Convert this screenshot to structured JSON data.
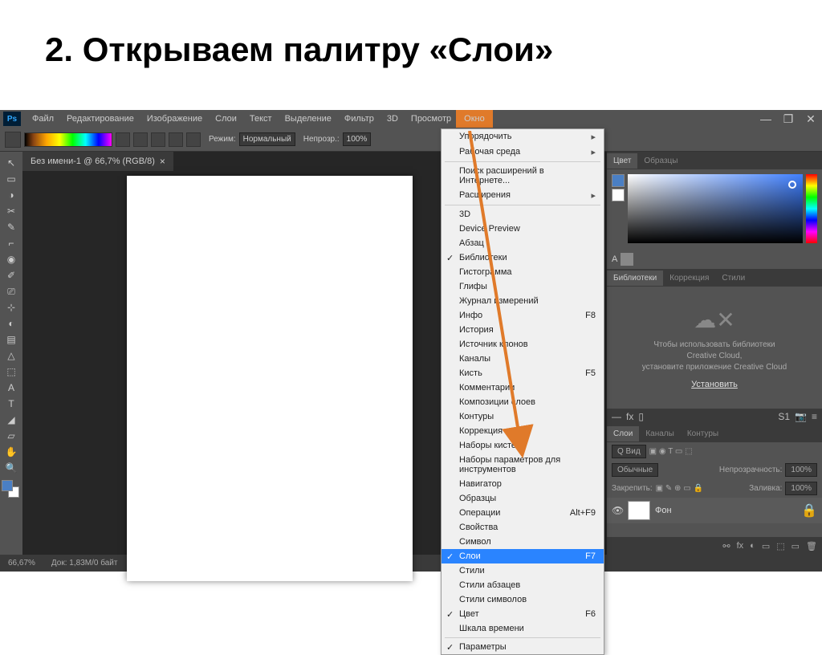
{
  "slide": {
    "title": "2. Открываем палитру «Слои»"
  },
  "menubar": {
    "items": [
      "Файл",
      "Редактирование",
      "Изображение",
      "Слои",
      "Текст",
      "Выделение",
      "Фильтр",
      "3D",
      "Просмотр",
      "Окно"
    ],
    "highlighted": "Окно"
  },
  "window_controls": {
    "minimize": "—",
    "maximize": "❐",
    "close": "✕"
  },
  "optionbar": {
    "mode_label": "Режим:",
    "mode_value": "Нормальный",
    "opacity_label": "Непрозр.:",
    "opacity_value": "100%"
  },
  "doc_tab": {
    "title": "Без имени-1 @ 66,7% (RGB/8)",
    "close": "×"
  },
  "tools": [
    "↖",
    "▭",
    "◑",
    "✂",
    "✎",
    "⌐",
    "◉",
    "✐",
    "⎚",
    "⊹",
    "◐",
    "▤",
    "△",
    "⬚",
    "A",
    "T",
    "◢",
    "▱",
    "✋",
    "🔍"
  ],
  "panels": {
    "color_tabs": [
      "Цвет",
      "Образцы"
    ],
    "char_label": "A",
    "lib_tabs": [
      "Библиотеки",
      "Коррекция",
      "Стили"
    ],
    "lib_text1": "Чтобы использовать библиотеки",
    "lib_text2": "Creative Cloud,",
    "lib_text3": "установите приложение Creative Cloud",
    "lib_link": "Установить",
    "fx_bar": {
      "dash": "—",
      "fx": "fx",
      "sq": "▯",
      "s1": "S1",
      "cam": "📷",
      "menu": "≡"
    },
    "layer_tabs": [
      "Слои",
      "Каналы",
      "Контуры"
    ],
    "layer_opts": {
      "kind": "Q Вид",
      "icons": "▣ ◉ T ▭ ⬚",
      "blend": "Обычные",
      "op_label": "Непрозрачность:",
      "op_val": "100%",
      "lock_label": "Закрепить:",
      "lock_icons": "▣ ✎ ⊕ ▭ 🔒",
      "fill_label": "Заливка:",
      "fill_val": "100%"
    },
    "layer": {
      "name": "Фон",
      "lock": "🔒"
    },
    "layer_bottom": [
      "⊕",
      "fx",
      "◐",
      "▭",
      "⬚",
      "🗑"
    ]
  },
  "statusbar": {
    "zoom": "66,67%",
    "doc": "Док: 1,83М/0 байт"
  },
  "dropdown": {
    "items": [
      {
        "label": "Упорядочить",
        "submenu": true
      },
      {
        "label": "Рабочая среда",
        "submenu": true
      },
      {
        "sep": true
      },
      {
        "label": "Поиск расширений в Интернете..."
      },
      {
        "label": "Расширения",
        "submenu": true
      },
      {
        "sep": true
      },
      {
        "label": "3D"
      },
      {
        "label": "Device Preview"
      },
      {
        "label": "Абзац"
      },
      {
        "label": "Библиотеки",
        "checked": true
      },
      {
        "label": "Гистограмма"
      },
      {
        "label": "Глифы"
      },
      {
        "label": "Журнал измерений"
      },
      {
        "label": "Инфо",
        "shortcut": "F8"
      },
      {
        "label": "История"
      },
      {
        "label": "Источник клонов"
      },
      {
        "label": "Каналы"
      },
      {
        "label": "Кисть",
        "shortcut": "F5"
      },
      {
        "label": "Комментарии"
      },
      {
        "label": "Композиции слоев"
      },
      {
        "label": "Контуры"
      },
      {
        "label": "Коррекция"
      },
      {
        "label": "Наборы кистей"
      },
      {
        "label": "Наборы параметров для инструментов"
      },
      {
        "label": "Навигатор"
      },
      {
        "label": "Образцы"
      },
      {
        "label": "Операции",
        "shortcut": "Alt+F9"
      },
      {
        "label": "Свойства"
      },
      {
        "label": "Символ"
      },
      {
        "label": "Слои",
        "shortcut": "F7",
        "checked": true,
        "highlighted": true
      },
      {
        "label": "Стили"
      },
      {
        "label": "Стили абзацев"
      },
      {
        "label": "Стили символов"
      },
      {
        "label": "Цвет",
        "checked": true,
        "shortcut": "F6"
      },
      {
        "label": "Шкала времени"
      },
      {
        "sep": true
      },
      {
        "label": "Параметры",
        "checked": true
      }
    ]
  }
}
